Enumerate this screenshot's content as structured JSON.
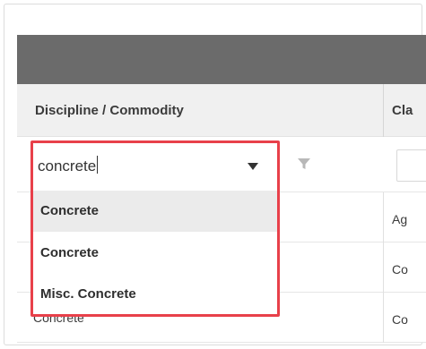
{
  "grid": {
    "columns": [
      {
        "label": "Discipline / Commodity"
      },
      {
        "label": "Cla"
      }
    ],
    "rows": [
      {
        "class_cell": "Ag",
        "discipline_cell": ""
      },
      {
        "class_cell": "Co",
        "discipline_cell": ""
      },
      {
        "class_cell": "Co",
        "discipline_cell": "Concrete"
      }
    ]
  },
  "filter": {
    "search_value": "concrete",
    "options": [
      {
        "label": "Concrete",
        "highlighted": true
      },
      {
        "label": "Concrete",
        "highlighted": false
      },
      {
        "label": "Misc. Concrete",
        "highlighted": false
      }
    ]
  },
  "colors": {
    "highlight_border": "#e8404a",
    "header_bar": "#6b6b6b",
    "header_row": "#f0f0f0",
    "option_hover": "#ebebeb"
  },
  "icons": {
    "dropdown_arrow": "triangle-down-icon",
    "filter": "funnel-icon"
  }
}
